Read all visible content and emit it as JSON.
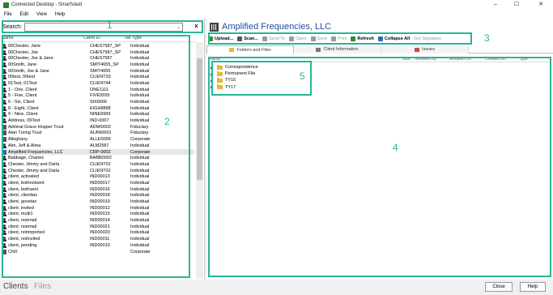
{
  "window": {
    "title": "Connected Desktop - SmartVault",
    "controls": [
      "–",
      "☐",
      "✕"
    ]
  },
  "menu": [
    "File",
    "Edit",
    "View",
    "Help"
  ],
  "search": {
    "label": "Search:",
    "value": "",
    "clear_label": "x"
  },
  "client_list": {
    "columns": [
      "Name",
      "Client ID",
      "Tax Type"
    ],
    "rows": [
      {
        "name": "00Chester, Jane",
        "id": "CHES7587_SP",
        "type": "Individual",
        "icon": "person"
      },
      {
        "name": "00Chester, Joe",
        "id": "CHES7587_SP",
        "type": "Individual",
        "icon": "person"
      },
      {
        "name": "00Chester, Joe & Jane",
        "id": "CHES7587",
        "type": "Individual",
        "icon": "person"
      },
      {
        "name": "00Smith, Jane",
        "id": "SMIT4655_SP",
        "type": "Individual",
        "icon": "person"
      },
      {
        "name": "00Smith, Joe & Jane",
        "id": "SMIT4655",
        "type": "Individual",
        "icon": "person"
      },
      {
        "name": "00test, 00test",
        "id": "CLIENT33",
        "type": "Individual",
        "icon": "person"
      },
      {
        "name": "01Test, 01Test",
        "id": "CLIENT44",
        "type": "Individual",
        "icon": "person"
      },
      {
        "name": "1 - One, Client",
        "id": "ONE1111",
        "type": "Individual",
        "icon": "person"
      },
      {
        "name": "5 - Five, Client",
        "id": "FIVE5555",
        "type": "Individual",
        "icon": "person"
      },
      {
        "name": "6 - Six, Client",
        "id": "SIX6666",
        "type": "Individual",
        "icon": "person"
      },
      {
        "name": "8 - Eight, Client",
        "id": "EIGH8888",
        "type": "Individual",
        "icon": "person"
      },
      {
        "name": "9 - Nine, Client",
        "id": "NINE9999",
        "type": "Individual",
        "icon": "person"
      },
      {
        "name": "Address, 09Test",
        "id": "IND-0007",
        "type": "Individual",
        "icon": "person"
      },
      {
        "name": "Admiral Grace Hopper Trust",
        "id": "ADMI0002",
        "type": "Fiduciary",
        "icon": "corp"
      },
      {
        "name": "Alan Turing Trust",
        "id": "ALAN0001",
        "type": "Fiduciary",
        "icon": "corp"
      },
      {
        "name": "Alleghany",
        "id": "ALLE0099",
        "type": "Corporate",
        "icon": "corp"
      },
      {
        "name": "Alm, Jeff & Alma",
        "id": "ALM2587",
        "type": "Individual",
        "icon": "person"
      },
      {
        "name": "Amplified Frequencies, LLC",
        "id": "CRP-0002",
        "type": "Corporate",
        "icon": "corp-blue"
      },
      {
        "name": "Babbage, Charles",
        "id": "BABB0002",
        "type": "Individual",
        "icon": "person"
      },
      {
        "name": "Chester, Jimmy and Darla",
        "id": "CLIENT02",
        "type": "Individual",
        "icon": "person"
      },
      {
        "name": "Chester, Jimmy and Darla",
        "id": "CLIENT02",
        "type": "Individual",
        "icon": "person"
      },
      {
        "name": "client, activated",
        "id": "IND00013",
        "type": "Individual",
        "icon": "person"
      },
      {
        "name": "client, bothnotsent",
        "id": "IND00017",
        "type": "Individual",
        "icon": "person"
      },
      {
        "name": "client, bothsent",
        "id": "IND00016",
        "type": "Individual",
        "icon": "person"
      },
      {
        "name": "client, clienttax",
        "id": "IND00018",
        "type": "Individual",
        "icon": "person"
      },
      {
        "name": "client, govetax",
        "id": "IND00019",
        "type": "Individual",
        "icon": "person"
      },
      {
        "name": "client, invited",
        "id": "IND00012",
        "type": "Individual",
        "icon": "person"
      },
      {
        "name": "client, multi1",
        "id": "IND00015",
        "type": "Individual",
        "icon": "person"
      },
      {
        "name": "client, noemail",
        "id": "IND00014",
        "type": "Individual",
        "icon": "person"
      },
      {
        "name": "client, noemail",
        "id": "IND00021",
        "type": "Individual",
        "icon": "person"
      },
      {
        "name": "client, notimported",
        "id": "IND00020",
        "type": "Individual",
        "icon": "person"
      },
      {
        "name": "client, notinvited",
        "id": "IND00011",
        "type": "Individual",
        "icon": "person"
      },
      {
        "name": "client, pending",
        "id": "IND00010",
        "type": "Individual",
        "icon": "person"
      },
      {
        "name": "CNX",
        "id": "",
        "type": "Corporate",
        "icon": "corp"
      }
    ],
    "selected_index": 17
  },
  "client_detail": {
    "name": "Amplified Frequencies, LLC",
    "toolbar": [
      {
        "label": "Upload...",
        "icon": "upload-icon",
        "color": "#3a8f3a",
        "disabled": false,
        "bold": true
      },
      {
        "label": "Scan...",
        "icon": "scan-icon",
        "color": "#555555",
        "disabled": false,
        "bold": true
      },
      {
        "label": "Send To",
        "icon": "send-icon",
        "color": "#9a9a9a",
        "disabled": true,
        "bold": false
      },
      {
        "label": "Open",
        "icon": "open-icon",
        "color": "#9a9a9a",
        "disabled": true,
        "bold": false
      },
      {
        "label": "Save",
        "icon": "save-icon",
        "color": "#9a9a9a",
        "disabled": true,
        "bold": false
      },
      {
        "label": "Print",
        "icon": "print-icon",
        "color": "#9a9a9a",
        "disabled": true,
        "bold": false
      },
      {
        "label": "Refresh",
        "icon": "refresh-icon",
        "color": "#2e8b3a",
        "disabled": false,
        "bold": true
      },
      {
        "label": "Collapse All",
        "icon": "collapse-icon",
        "color": "#2c6cb0",
        "disabled": false,
        "bold": true
      },
      {
        "label": "Get Signature",
        "icon": "",
        "color": "#9a9a9a",
        "disabled": true,
        "bold": false
      }
    ],
    "tabs": [
      {
        "label": "Folders and Files",
        "active": true,
        "icon": "folder-icon"
      },
      {
        "label": "Client Information",
        "active": false,
        "icon": "info-icon"
      },
      {
        "label": "Issues",
        "active": false,
        "icon": "issues-icon"
      }
    ],
    "file_columns": [
      "Name",
      "Size",
      "Modified By",
      "Modified On",
      "Created On",
      "Type"
    ],
    "folders": [
      "Correspondence",
      "Permanent File",
      "TY15",
      "TY17"
    ]
  },
  "bottom": {
    "tab_clients": "Clients",
    "tab_files": "Files",
    "close_label": "Close",
    "help_label": "Help"
  },
  "annotations": [
    "1",
    "2",
    "3",
    "4",
    "5"
  ],
  "colors": {
    "annotation": "#2ab598",
    "client_title": "#1f4e9e",
    "folder": "#e7b73a"
  }
}
